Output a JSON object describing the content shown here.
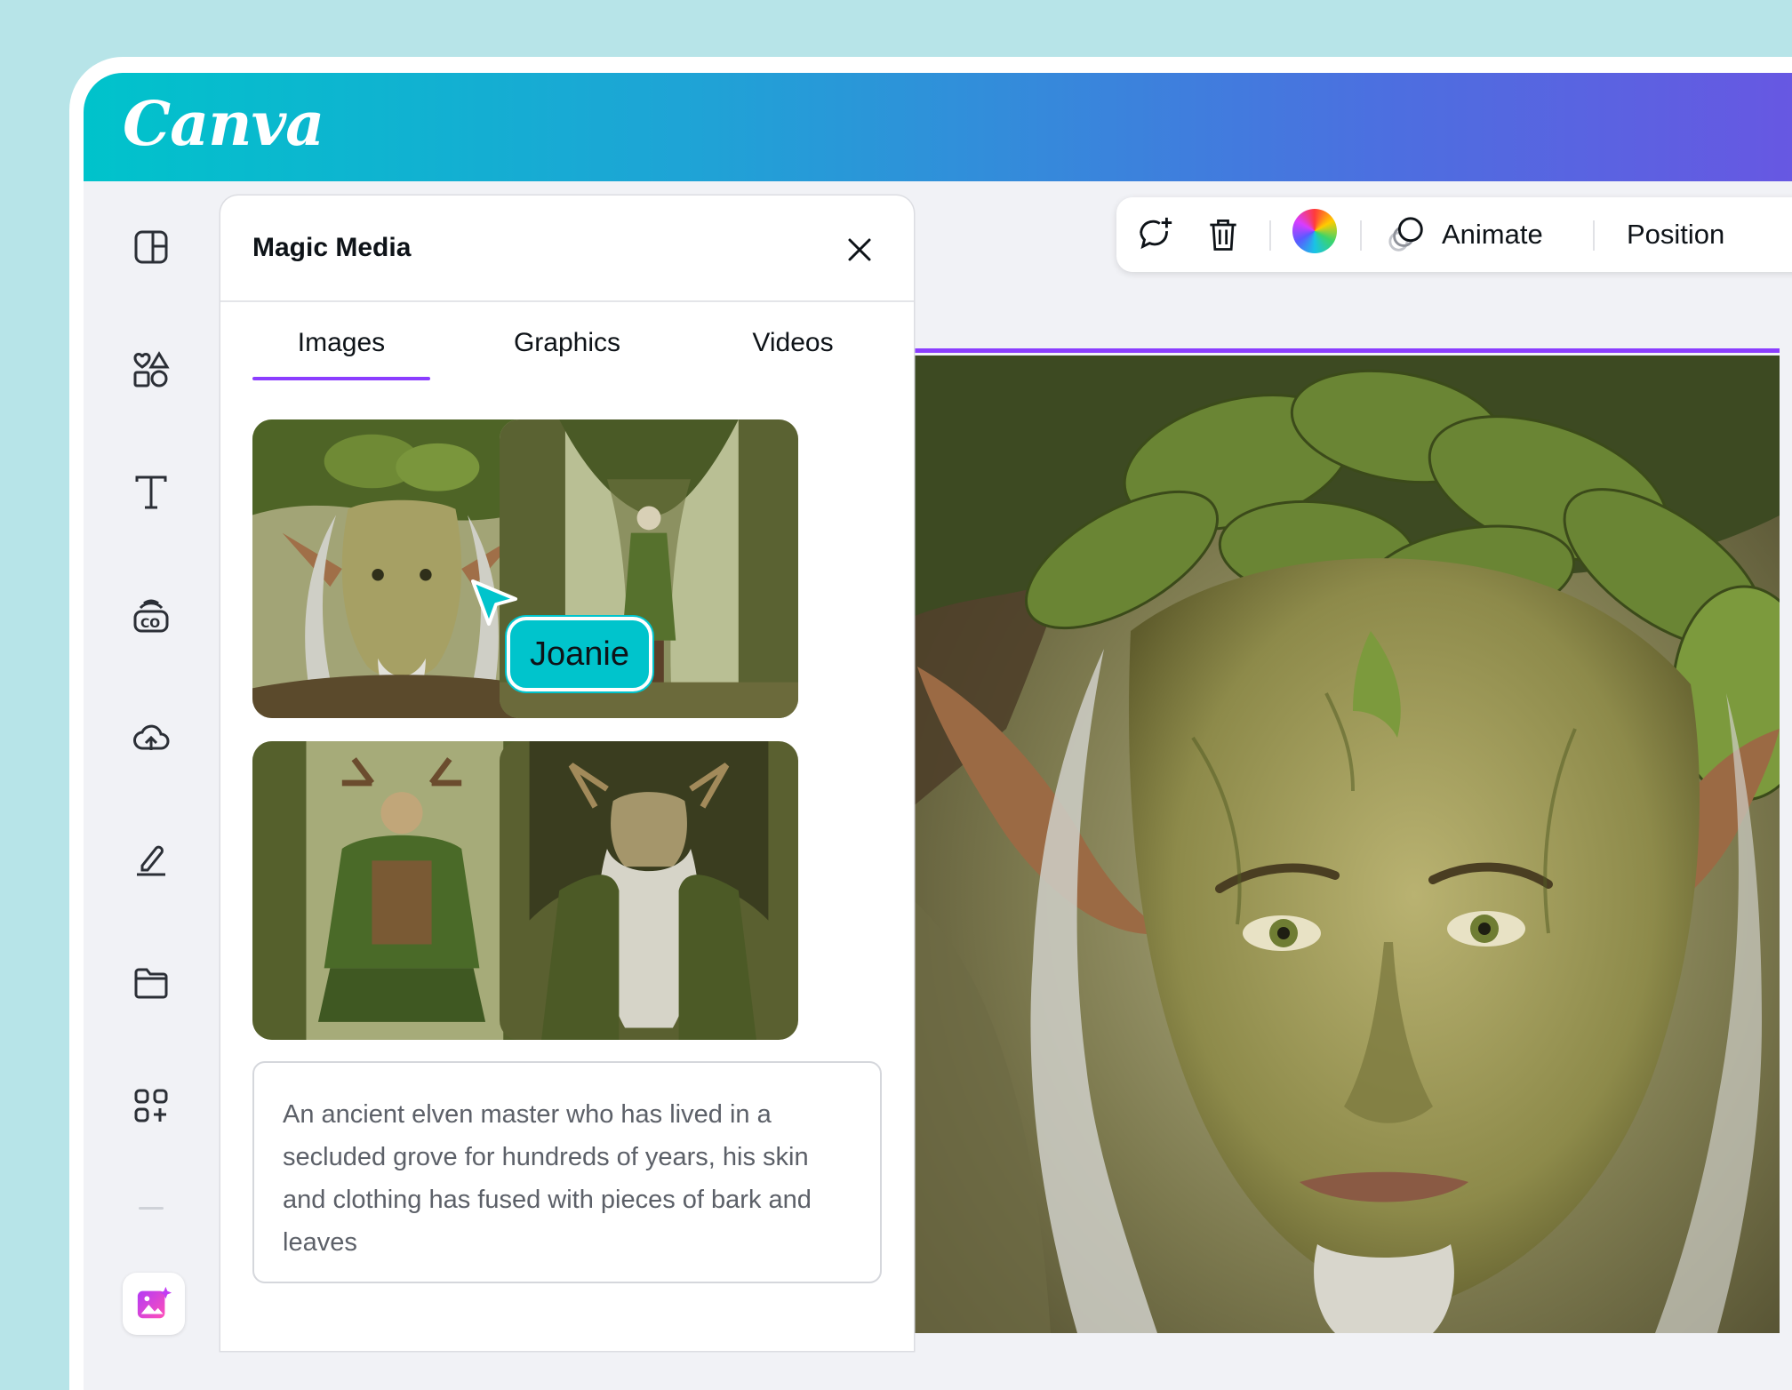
{
  "app": {
    "logo_text": "Canva"
  },
  "sidebar": {
    "icons": [
      "design-icon",
      "elements-icon",
      "text-icon",
      "brand-icon",
      "uploads-icon",
      "draw-icon",
      "projects-icon",
      "apps-icon"
    ],
    "active_app_icon": "magic-media-icon"
  },
  "panel": {
    "title": "Magic Media",
    "tabs": [
      {
        "label": "Images",
        "active": true
      },
      {
        "label": "Graphics",
        "active": false
      },
      {
        "label": "Videos",
        "active": false
      }
    ],
    "results": [
      "elf-portrait-thumbnail",
      "elf-standing-in-forest-thumbnail",
      "elf-seated-with-antlers-thumbnail",
      "elf-long-beard-thumbnail"
    ],
    "prompt": "An ancient elven master who has lived in a secluded grove for hundreds of years, his skin and clothing has fused with pieces of bark and leaves"
  },
  "collaborator": {
    "name": "Joanie",
    "color": "#00c4cc"
  },
  "toolbar": {
    "animate_label": "Animate",
    "position_label": "Position"
  },
  "colors": {
    "accent": "#8b3dff",
    "header_start": "#00c3cb",
    "header_end": "#6a55e2",
    "background": "#b7e4e8"
  }
}
